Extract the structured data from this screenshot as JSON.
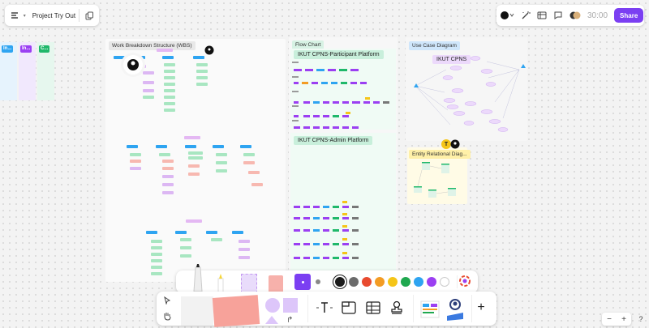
{
  "board": {
    "title": "Project Try Out"
  },
  "toolbar": {
    "timer": "30:00",
    "share_label": "Share"
  },
  "columns": [
    {
      "label": "In...",
      "color": "#2ea4f1"
    },
    {
      "label": "In...",
      "color": "#9b3ff2"
    },
    {
      "label": "C...",
      "color": "#1fb86a"
    }
  ],
  "frames": {
    "wbs": "Work Breakdown Structure (WBS)",
    "flow": "Flow Chart",
    "flow_participant": "IKUT CPNS-Participant Platform",
    "flow_admin": "IKUT CPNS-Admin Platform",
    "usecase": "Use Case Diagram",
    "usecase_system": "IKUT CPNS",
    "erd": "Entity Relational Diag..."
  },
  "avatar_initial": "T",
  "palette": [
    "#1b1b1b",
    "#6b6b6b",
    "#e84a2f",
    "#f39c24",
    "#f5c518",
    "#1fa84f",
    "#2ea4f1",
    "#9b3ff2",
    "#ffffff"
  ],
  "zoom": {
    "minus": "−",
    "plus": "+"
  },
  "help": "?"
}
